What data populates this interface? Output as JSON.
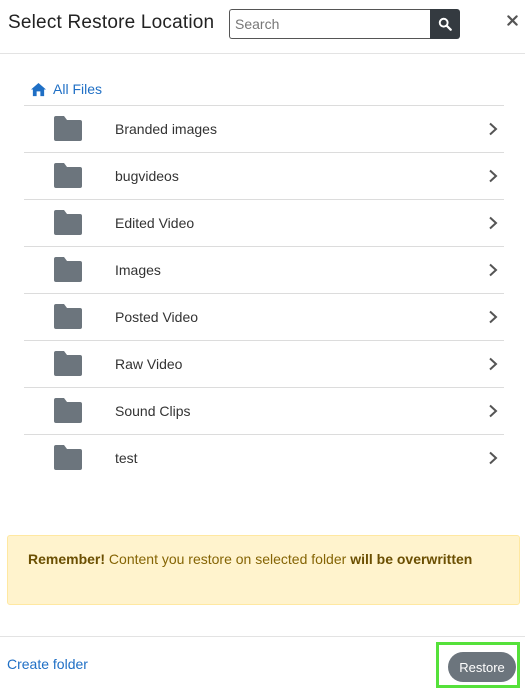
{
  "dialog": {
    "title": "Select Restore Location",
    "close_symbol": "×"
  },
  "search": {
    "placeholder": "Search",
    "value": "",
    "icon": "search-icon"
  },
  "breadcrumb": {
    "label": "All Files",
    "icon": "home-icon"
  },
  "folders": [
    {
      "name": "Branded images"
    },
    {
      "name": "bugvideos"
    },
    {
      "name": "Edited Video"
    },
    {
      "name": "Images"
    },
    {
      "name": "Posted Video"
    },
    {
      "name": "Raw Video"
    },
    {
      "name": "Sound Clips"
    },
    {
      "name": "test"
    }
  ],
  "alert": {
    "strong_prefix": "Remember!",
    "text": " Content you restore on selected folder ",
    "strong_suffix": "will be overwritten"
  },
  "footer": {
    "create_folder_label": "Create folder",
    "restore_label": "Restore"
  },
  "colors": {
    "link": "#1f6fc5",
    "folder_icon": "#6c757d",
    "alert_bg": "#fff3cd",
    "restore_bg": "#6c757d",
    "highlight": "#55e13a"
  }
}
